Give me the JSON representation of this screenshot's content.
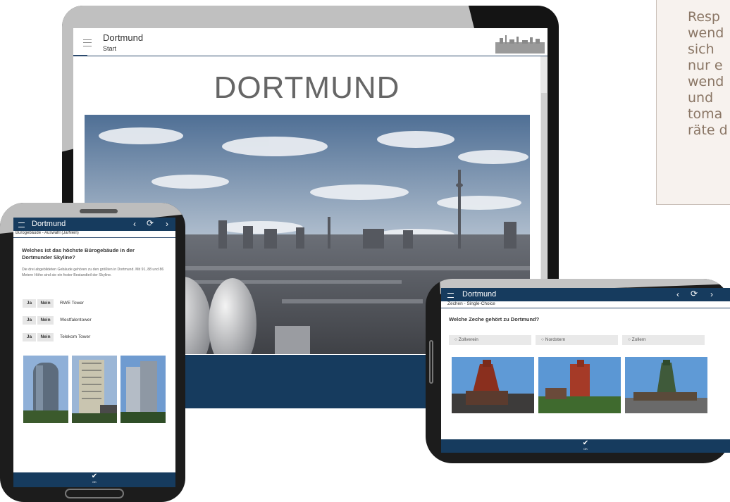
{
  "note": {
    "text": "Resp\nwend\nsich\nnur e\nwend\nund\ntoma\nräte d"
  },
  "tablet": {
    "app_title": "Dortmund",
    "breadcrumb": "Start",
    "heading": "DORTMUND"
  },
  "phone": {
    "app_title": "Dortmund",
    "breadcrumb": "Bürogebäude - Auswahl (Ja/Nein)",
    "question": "Welches ist das höchste Bürogebäude in der Dortmunder Skyline?",
    "description": "Die drei abgebildeten Gebäude gehören zu den größten in Dortmund. Mit 91, 88 und 86 Metern Höhe sind sie ein fester Bestandteil der Skyline.",
    "yes_label": "Ja",
    "no_label": "Nein",
    "options": [
      "RWE Tower",
      "Westfalentower",
      "Telekom Tower"
    ],
    "ok_label": "OK"
  },
  "small_tablet": {
    "app_title": "Dortmund",
    "breadcrumb": "Zechen - Single-Choice",
    "question": "Welche Zeche gehört zu Dortmund?",
    "options": [
      "Zollverein",
      "Nordstern",
      "Zollern"
    ],
    "ok_label": "OK"
  },
  "icons": [
    "menu-icon",
    "chevron-left-icon",
    "refresh-icon",
    "chevron-right-icon",
    "checkmark-icon",
    "radio-icon"
  ],
  "colors": {
    "brand": "#163b5e",
    "note_text": "#8a7665",
    "note_bg": "#f7f2ee"
  }
}
